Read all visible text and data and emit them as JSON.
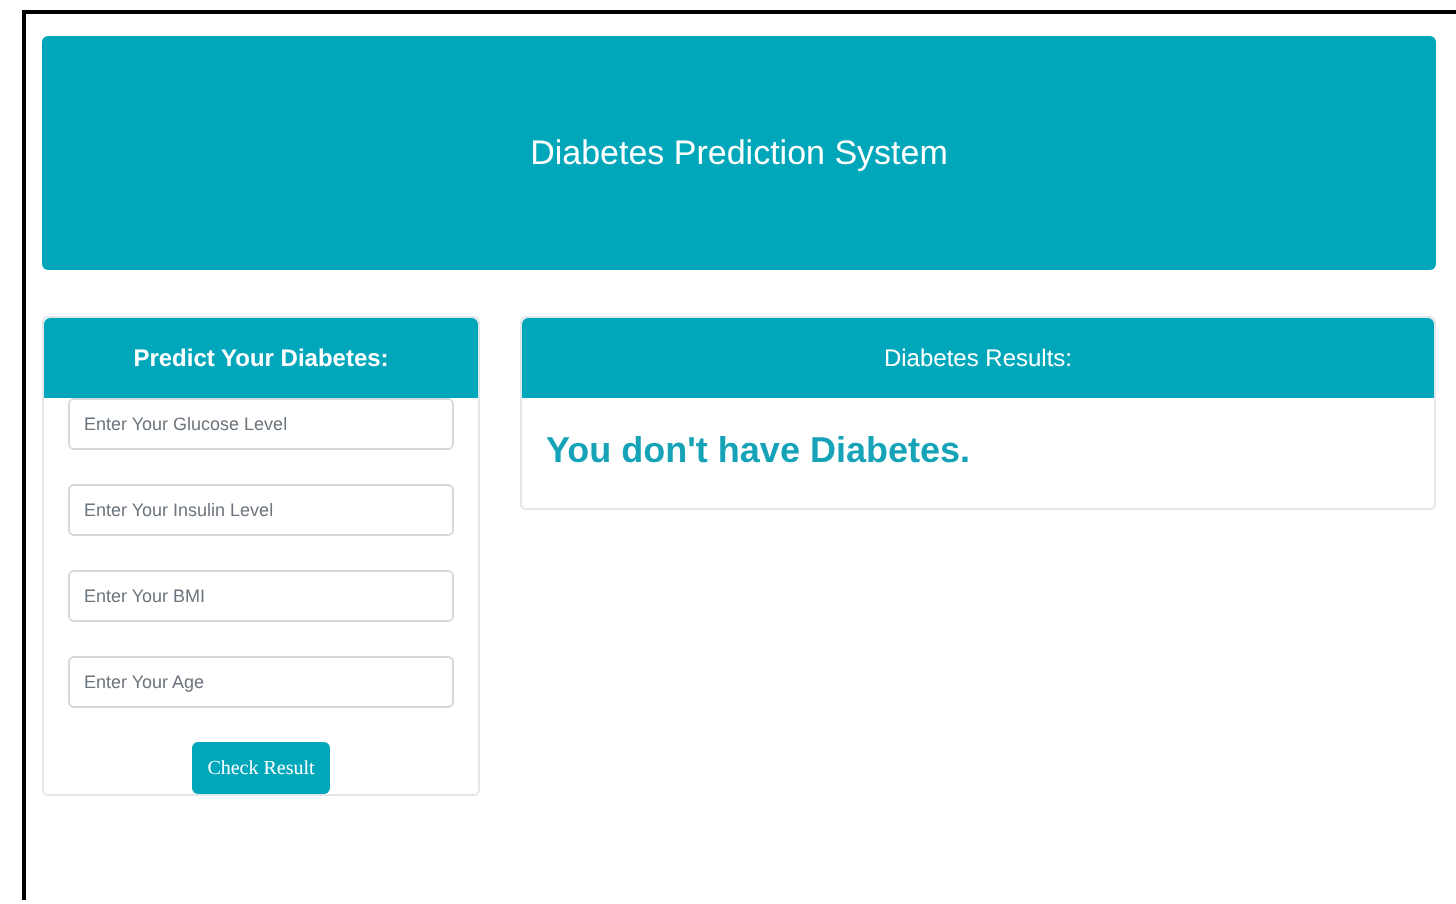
{
  "header": {
    "title": "Diabetes Prediction System"
  },
  "form_panel": {
    "title": "Predict Your Diabetes:",
    "fields": [
      {
        "placeholder": "Enter Your Glucose Level"
      },
      {
        "placeholder": "Enter Your Insulin Level"
      },
      {
        "placeholder": "Enter Your BMI"
      },
      {
        "placeholder": "Enter Your Age"
      }
    ],
    "button": "Check Result"
  },
  "results_panel": {
    "title": "Diabetes Results:",
    "message": "You don't have Diabetes."
  }
}
